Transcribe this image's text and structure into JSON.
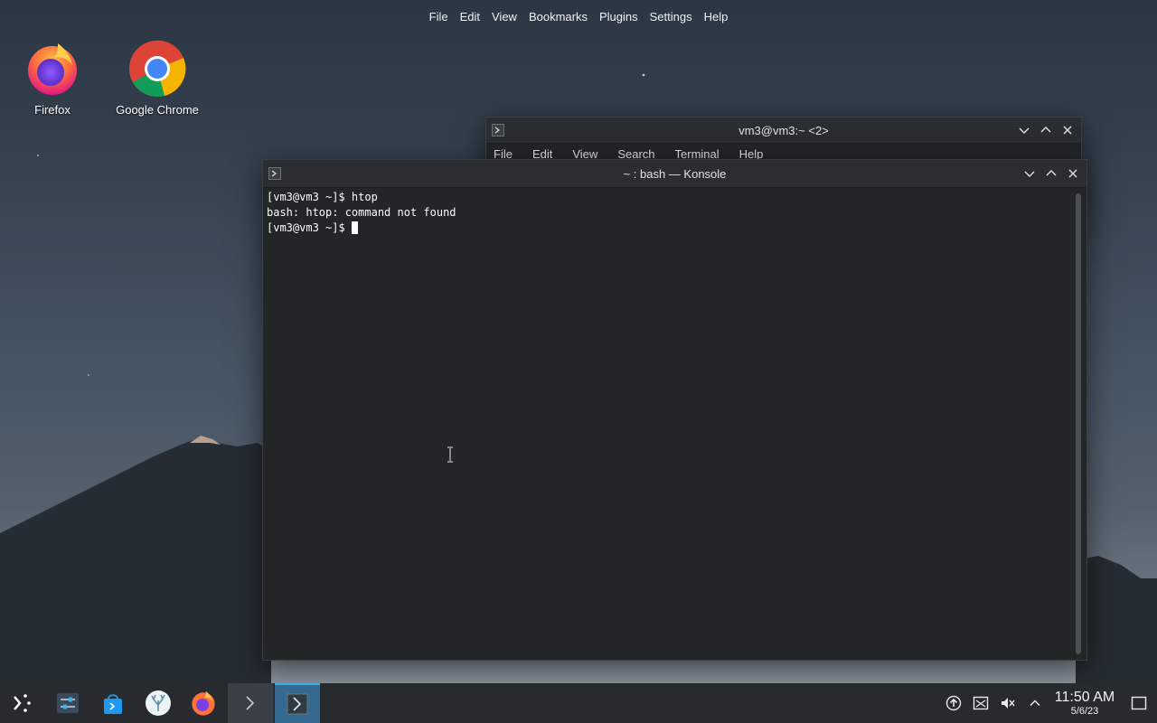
{
  "global_menu": [
    "File",
    "Edit",
    "View",
    "Bookmarks",
    "Plugins",
    "Settings",
    "Help"
  ],
  "desktop_icons": [
    {
      "label": "Firefox",
      "icon": "firefox-icon"
    },
    {
      "label": "Google Chrome",
      "icon": "chrome-icon"
    }
  ],
  "back_window": {
    "title": "vm3@vm3:~ <2>",
    "menu": [
      "File",
      "Edit",
      "View",
      "Search",
      "Terminal",
      "Help"
    ]
  },
  "front_window": {
    "title": "~ : bash — Konsole",
    "lines": [
      "[vm3@vm3 ~]$ htop",
      "bash: htop: command not found",
      "[vm3@vm3 ~]$ "
    ]
  },
  "taskbar": {
    "launcher_icon": "app-launcher-icon",
    "pinned": [
      "system-settings-icon",
      "discover-store-icon",
      "coral-app-icon",
      "firefox-icon"
    ],
    "tasks": [
      {
        "icon": "terminal-icon",
        "state": "inactive"
      },
      {
        "icon": "terminal-icon",
        "state": "active"
      }
    ]
  },
  "tray": {
    "icons": [
      "update-icon",
      "screen-icon",
      "volume-muted-icon",
      "chevron-up-icon"
    ],
    "time": "11:50 AM",
    "date": "5/6/23",
    "show_desktop": "show-desktop-icon"
  },
  "colors": {
    "accent": "#3daee9",
    "terminal_bg": "#232627",
    "titlebar": "#2a2e32",
    "taskbar": "#272b30"
  }
}
